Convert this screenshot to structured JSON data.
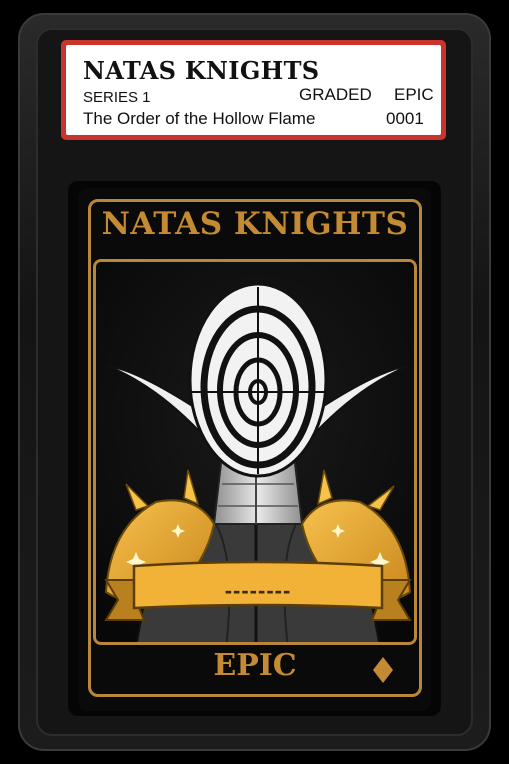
{
  "label": {
    "brand": "NATAS KNIGHTS",
    "series": "SERIES 1",
    "graded": "GRADED",
    "grade": "EPIC",
    "subtitle": "The Order of the Hollow Flame",
    "number": "0001"
  },
  "card": {
    "title": "NATAS KNIGHTS",
    "banner_text": "--------",
    "rarity": "EPIC"
  },
  "colors": {
    "label_border": "#c9352c",
    "gold": "#c48a34",
    "armor": "#e8a531"
  }
}
